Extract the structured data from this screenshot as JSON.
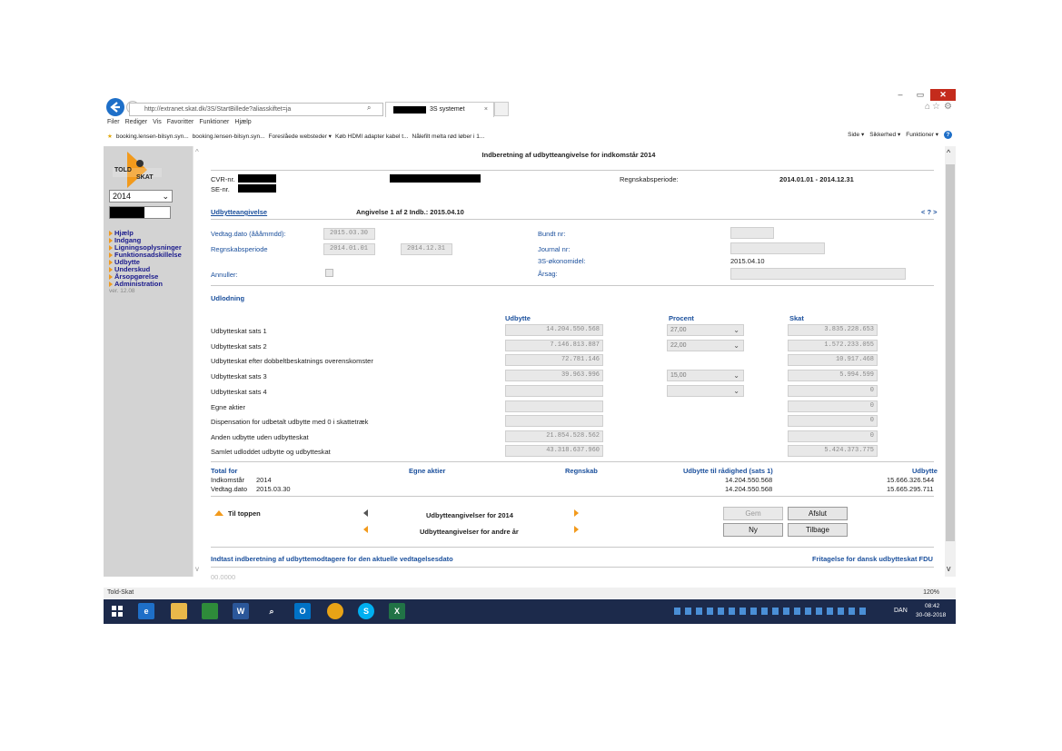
{
  "browser": {
    "address": "http://extranet.skat.dk/3S/StartBillede?aliasskiftet=ja",
    "tab_title": "3S systemet",
    "window_controls": {
      "minimize": "–",
      "restore": "▭",
      "close": "✕"
    },
    "menu": [
      "Filer",
      "Rediger",
      "Vis",
      "Favoritter",
      "Funktioner",
      "Hjælp"
    ],
    "favorites": [
      "booking.lensen-bilsyn.syn...",
      "booking.lensen-bilsyn.syn...",
      "Foreslåede websteder ▾",
      "Køb HDMI adapter kabel t...",
      "Nålefilt melta rød løber i 1..."
    ],
    "commands": [
      "Side ▾",
      "Sikkerhed ▾",
      "Funktioner ▾"
    ],
    "status_title": "Told-Skat",
    "zoom": "120%"
  },
  "sidebar": {
    "logo_top": "TOLD",
    "logo_bottom": "SKAT",
    "year": "2014",
    "items": [
      "Hjælp",
      "Indgang",
      "Ligningsoplysninger",
      "Funktionsadskillelse",
      "Udbytte",
      "Underskud",
      "Årsopgørelse",
      "Administration"
    ],
    "version": "ver. 12.08"
  },
  "page": {
    "title": "Indberetning af udbytteangivelse for indkomstår 2014",
    "cvr_label": "CVR-nr.",
    "se_label": "SE-nr.",
    "period_label": "Regnskabsperiode:",
    "period_value": "2014.01.01 - 2014.12.31",
    "section_tab": "Udbytteangivelse",
    "angivelse": "Angivelse 1 af 2 Indb.: 2015.04.10",
    "help": "< ? >",
    "vedtag_label": "Vedtag.dato (åååmmdd):",
    "vedtag_value": "2015.03.30",
    "regnskab_label": "Regnskabsperiode",
    "regnskab_from": "2014.01.01",
    "regnskab_to": "2014.12.31",
    "annuller_label": "Annuller:",
    "bundt_label": "Bundt nr:",
    "journal_label": "Journal nr:",
    "okonomi_label": "3S-økonomidel:",
    "okonomi_value": "2015.04.10",
    "arsag_label": "Årsag:"
  },
  "udlodning": {
    "heading": "Udlodning",
    "col_udbytte": "Udbytte",
    "col_procent": "Procent",
    "col_skat": "Skat",
    "rows": [
      {
        "label": "Udbytteskat sats 1",
        "udbytte": "14.204.550.568",
        "procent": "27,00",
        "skat": "3.835.228.653"
      },
      {
        "label": "Udbytteskat sats 2",
        "udbytte": "7.146.813.887",
        "procent": "22,00",
        "skat": "1.572.233.055"
      },
      {
        "label": "Udbytteskat efter dobbeltbeskatnings overenskomster",
        "udbytte": "72.781.146",
        "procent": "",
        "skat": "10.917.468"
      },
      {
        "label": "Udbytteskat sats 3",
        "udbytte": "39.963.996",
        "procent": "15,00",
        "skat": "5.994.599"
      },
      {
        "label": "Udbytteskat sats 4",
        "udbytte": "",
        "procent": "",
        "skat": "0"
      },
      {
        "label": "Egne aktier",
        "udbytte": "",
        "procent": "",
        "skat": "0"
      },
      {
        "label": "Dispensation for udbetalt udbytte med 0 i skattetræk",
        "udbytte": "",
        "procent": "",
        "skat": "0"
      },
      {
        "label": "Anden udbytte uden udbytteskat",
        "udbytte": "21.854.528.562",
        "procent": "",
        "skat": "0"
      },
      {
        "label": "Samlet udloddet udbytte og udbytteskat",
        "udbytte": "43.318.637.960",
        "procent": "",
        "skat": "5.424.373.775"
      }
    ]
  },
  "totals": {
    "total_for": "Total for",
    "egne": "Egne aktier",
    "regnskab": "Regnskab",
    "til_radighed": "Udbytte til rådighed (sats 1)",
    "udbytte": "Udbytte",
    "r1_label": "Indkomstår",
    "r1_value": "2014",
    "r1_radighed": "14.204.550.568",
    "r1_udbytte": "15.666.326.544",
    "r2_label": "Vedtag.dato",
    "r2_value": "2015.03.30",
    "r2_radighed": "14.204.550.568",
    "r2_udbytte": "15.665.295.711"
  },
  "footer": {
    "til_toppen": "Til toppen",
    "nav_2014": "Udbytteangivelser for 2014",
    "nav_andre": "Udbytteangivelser for andre år",
    "gem": "Gem",
    "afslut": "Afslut",
    "ny": "Ny",
    "tilbage": "Tilbage",
    "indtast_link": "Indtast indberetning af udbyttemodtagere for den aktuelle vedtagelsesdato",
    "fritagelse_link": "Fritagelse for dansk udbytteskat FDU",
    "cut_text": "00.0000"
  },
  "taskbar": {
    "lang": "DAN",
    "time": "08:42",
    "date": "30-08-2018"
  },
  "colors": {
    "accent": "#f29a1c",
    "link": "#1a4f9c",
    "taskbar": "#1c2a4b",
    "close": "#c42b1c"
  }
}
